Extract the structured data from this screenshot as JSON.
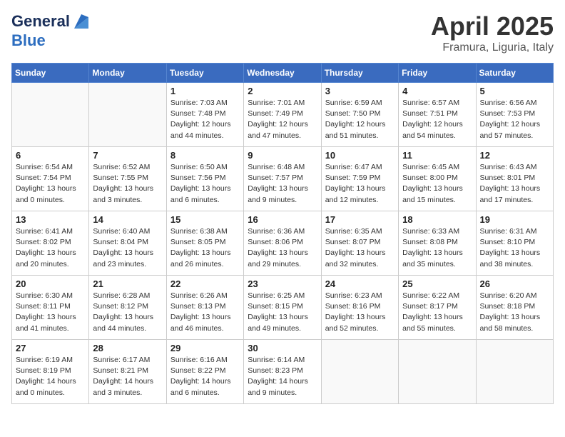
{
  "header": {
    "logo_general": "General",
    "logo_blue": "Blue",
    "month": "April 2025",
    "location": "Framura, Liguria, Italy"
  },
  "weekdays": [
    "Sunday",
    "Monday",
    "Tuesday",
    "Wednesday",
    "Thursday",
    "Friday",
    "Saturday"
  ],
  "weeks": [
    [
      {
        "day": "",
        "info": ""
      },
      {
        "day": "",
        "info": ""
      },
      {
        "day": "1",
        "info": "Sunrise: 7:03 AM\nSunset: 7:48 PM\nDaylight: 12 hours\nand 44 minutes."
      },
      {
        "day": "2",
        "info": "Sunrise: 7:01 AM\nSunset: 7:49 PM\nDaylight: 12 hours\nand 47 minutes."
      },
      {
        "day": "3",
        "info": "Sunrise: 6:59 AM\nSunset: 7:50 PM\nDaylight: 12 hours\nand 51 minutes."
      },
      {
        "day": "4",
        "info": "Sunrise: 6:57 AM\nSunset: 7:51 PM\nDaylight: 12 hours\nand 54 minutes."
      },
      {
        "day": "5",
        "info": "Sunrise: 6:56 AM\nSunset: 7:53 PM\nDaylight: 12 hours\nand 57 minutes."
      }
    ],
    [
      {
        "day": "6",
        "info": "Sunrise: 6:54 AM\nSunset: 7:54 PM\nDaylight: 13 hours\nand 0 minutes."
      },
      {
        "day": "7",
        "info": "Sunrise: 6:52 AM\nSunset: 7:55 PM\nDaylight: 13 hours\nand 3 minutes."
      },
      {
        "day": "8",
        "info": "Sunrise: 6:50 AM\nSunset: 7:56 PM\nDaylight: 13 hours\nand 6 minutes."
      },
      {
        "day": "9",
        "info": "Sunrise: 6:48 AM\nSunset: 7:57 PM\nDaylight: 13 hours\nand 9 minutes."
      },
      {
        "day": "10",
        "info": "Sunrise: 6:47 AM\nSunset: 7:59 PM\nDaylight: 13 hours\nand 12 minutes."
      },
      {
        "day": "11",
        "info": "Sunrise: 6:45 AM\nSunset: 8:00 PM\nDaylight: 13 hours\nand 15 minutes."
      },
      {
        "day": "12",
        "info": "Sunrise: 6:43 AM\nSunset: 8:01 PM\nDaylight: 13 hours\nand 17 minutes."
      }
    ],
    [
      {
        "day": "13",
        "info": "Sunrise: 6:41 AM\nSunset: 8:02 PM\nDaylight: 13 hours\nand 20 minutes."
      },
      {
        "day": "14",
        "info": "Sunrise: 6:40 AM\nSunset: 8:04 PM\nDaylight: 13 hours\nand 23 minutes."
      },
      {
        "day": "15",
        "info": "Sunrise: 6:38 AM\nSunset: 8:05 PM\nDaylight: 13 hours\nand 26 minutes."
      },
      {
        "day": "16",
        "info": "Sunrise: 6:36 AM\nSunset: 8:06 PM\nDaylight: 13 hours\nand 29 minutes."
      },
      {
        "day": "17",
        "info": "Sunrise: 6:35 AM\nSunset: 8:07 PM\nDaylight: 13 hours\nand 32 minutes."
      },
      {
        "day": "18",
        "info": "Sunrise: 6:33 AM\nSunset: 8:08 PM\nDaylight: 13 hours\nand 35 minutes."
      },
      {
        "day": "19",
        "info": "Sunrise: 6:31 AM\nSunset: 8:10 PM\nDaylight: 13 hours\nand 38 minutes."
      }
    ],
    [
      {
        "day": "20",
        "info": "Sunrise: 6:30 AM\nSunset: 8:11 PM\nDaylight: 13 hours\nand 41 minutes."
      },
      {
        "day": "21",
        "info": "Sunrise: 6:28 AM\nSunset: 8:12 PM\nDaylight: 13 hours\nand 44 minutes."
      },
      {
        "day": "22",
        "info": "Sunrise: 6:26 AM\nSunset: 8:13 PM\nDaylight: 13 hours\nand 46 minutes."
      },
      {
        "day": "23",
        "info": "Sunrise: 6:25 AM\nSunset: 8:15 PM\nDaylight: 13 hours\nand 49 minutes."
      },
      {
        "day": "24",
        "info": "Sunrise: 6:23 AM\nSunset: 8:16 PM\nDaylight: 13 hours\nand 52 minutes."
      },
      {
        "day": "25",
        "info": "Sunrise: 6:22 AM\nSunset: 8:17 PM\nDaylight: 13 hours\nand 55 minutes."
      },
      {
        "day": "26",
        "info": "Sunrise: 6:20 AM\nSunset: 8:18 PM\nDaylight: 13 hours\nand 58 minutes."
      }
    ],
    [
      {
        "day": "27",
        "info": "Sunrise: 6:19 AM\nSunset: 8:19 PM\nDaylight: 14 hours\nand 0 minutes."
      },
      {
        "day": "28",
        "info": "Sunrise: 6:17 AM\nSunset: 8:21 PM\nDaylight: 14 hours\nand 3 minutes."
      },
      {
        "day": "29",
        "info": "Sunrise: 6:16 AM\nSunset: 8:22 PM\nDaylight: 14 hours\nand 6 minutes."
      },
      {
        "day": "30",
        "info": "Sunrise: 6:14 AM\nSunset: 8:23 PM\nDaylight: 14 hours\nand 9 minutes."
      },
      {
        "day": "",
        "info": ""
      },
      {
        "day": "",
        "info": ""
      },
      {
        "day": "",
        "info": ""
      }
    ]
  ]
}
